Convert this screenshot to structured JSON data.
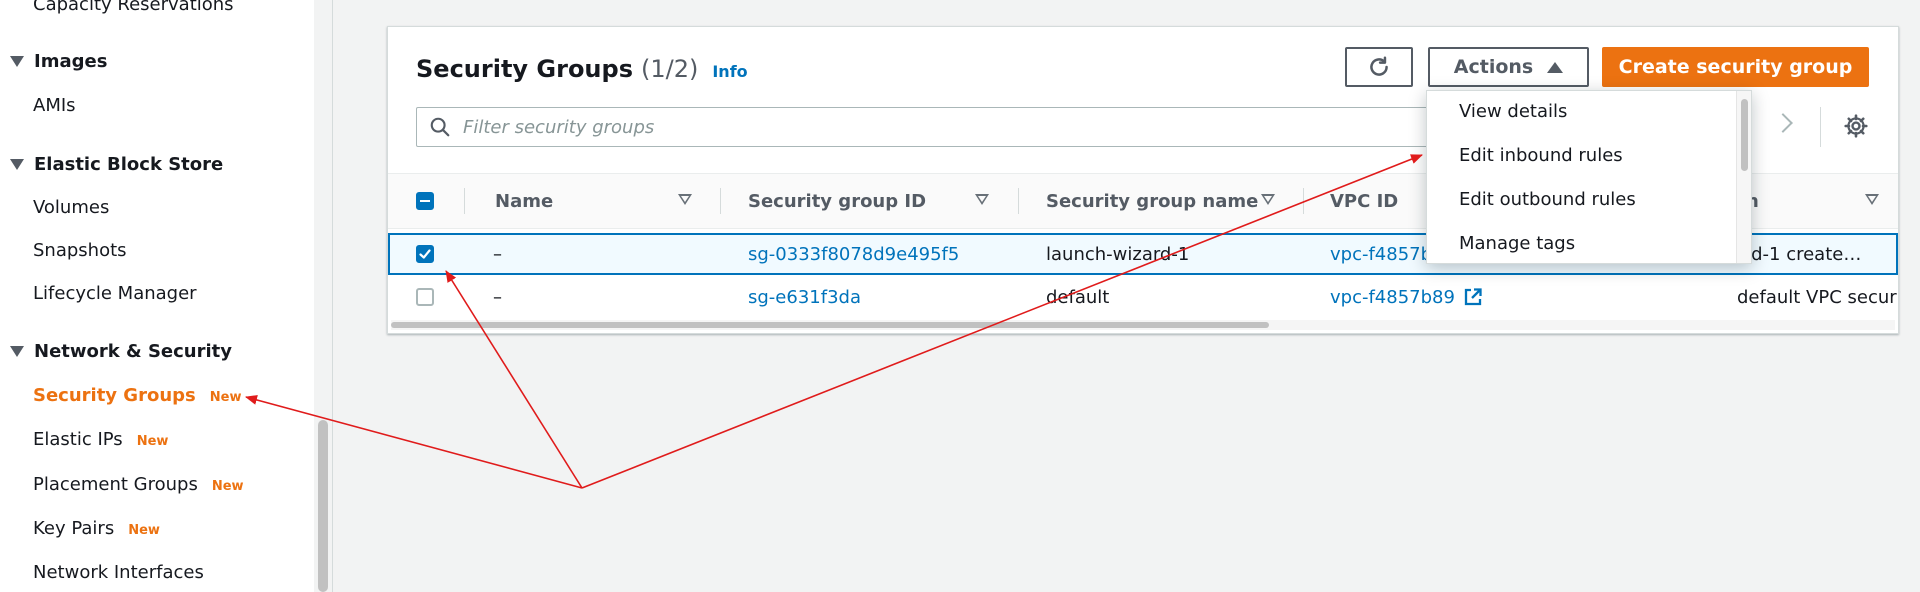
{
  "sidebar": {
    "top_partial_item": "Capacity Reservations",
    "sections": [
      {
        "title": "Images",
        "items": [
          {
            "label": "AMIs",
            "badge": ""
          }
        ]
      },
      {
        "title": "Elastic Block Store",
        "items": [
          {
            "label": "Volumes",
            "badge": ""
          },
          {
            "label": "Snapshots",
            "badge": ""
          },
          {
            "label": "Lifecycle Manager",
            "badge": ""
          }
        ]
      },
      {
        "title": "Network & Security",
        "items": [
          {
            "label": "Security Groups",
            "badge": "New",
            "active": true
          },
          {
            "label": "Elastic IPs",
            "badge": "New"
          },
          {
            "label": "Placement Groups",
            "badge": "New"
          },
          {
            "label": "Key Pairs",
            "badge": "New"
          },
          {
            "label": "Network Interfaces",
            "badge": ""
          }
        ]
      }
    ]
  },
  "panel": {
    "title": "Security Groups",
    "count": "(1/2)",
    "info": "Info",
    "actions_label": "Actions",
    "create_label": "Create security group",
    "filter_placeholder": "Filter security groups"
  },
  "table": {
    "columns": [
      "Name",
      "Security group ID",
      "Security group name",
      "VPC ID",
      "n"
    ],
    "rows": [
      {
        "selected": true,
        "name": "–",
        "sg_id": "sg-0333f8078d9e495f5",
        "sg_name": "launch-wizard-1",
        "vpc_id": "vpc-f4857b",
        "description": "ard-1 create…"
      },
      {
        "selected": false,
        "name": "–",
        "sg_id": "sg-e631f3da",
        "sg_name": "default",
        "vpc_id": "vpc-f4857b89",
        "description": "default VPC security gr…"
      }
    ]
  },
  "actions_menu": {
    "items": [
      "View details",
      "Edit inbound rules",
      "Edit outbound rules",
      "Manage tags"
    ]
  },
  "colors": {
    "accent_orange": "#ec7211",
    "link_blue": "#0073bb",
    "annotation_red": "#e01b1b"
  },
  "icons": {
    "refresh": "refresh-icon",
    "search": "search-icon",
    "gear": "gear-icon",
    "external": "external-link-icon"
  }
}
